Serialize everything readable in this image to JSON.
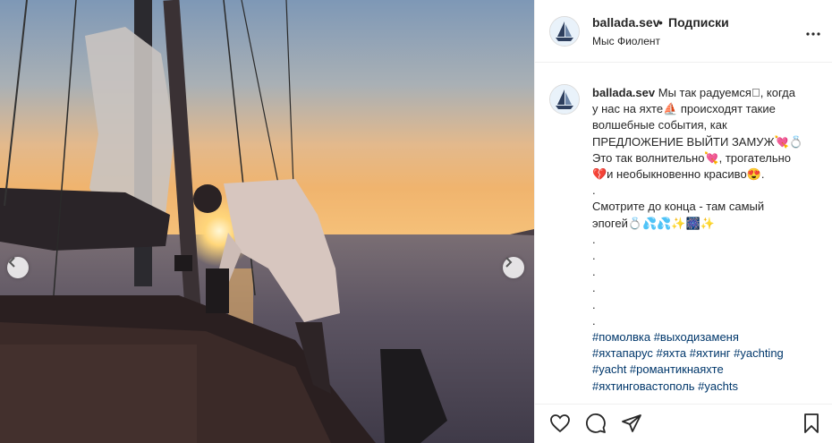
{
  "post": {
    "username": "ballada.sev",
    "separator": "•",
    "follow_label": "Подписки",
    "location": "Мыс Фиолент"
  },
  "caption": {
    "username": "ballada.sev",
    "lines": [
      "Мы так радуемся\u0000, когда",
      "у нас на яхте⛵ происходят такие",
      "волшебные события, как",
      "ПРЕДЛОЖЕНИЕ ВЫЙТИ ЗАМУЖ💘💍",
      "Это так волнительно💘, трогательно",
      "💔и необыкновенно красиво😍.",
      ".",
      "Смотрите до конца - там самый",
      "эпогей💍💦💦✨🎆✨",
      ".",
      ".",
      ".",
      ".",
      ".",
      "."
    ],
    "hashtags": [
      "#помолвка #выходизаменя",
      "#яхтапарус #яхта #яхтинг #yachting",
      "#yacht #романтикнаяхте",
      "#яхтинговастополь #yachts"
    ]
  },
  "icons": {
    "more": "more-options-icon",
    "prev": "chevron-left-icon",
    "next": "chevron-right-icon",
    "like": "heart-icon",
    "comment": "comment-icon",
    "share": "paper-plane-icon",
    "save": "bookmark-icon"
  },
  "colors": {
    "hashtag": "#00376b",
    "text": "#262626",
    "border": "#efefef"
  }
}
